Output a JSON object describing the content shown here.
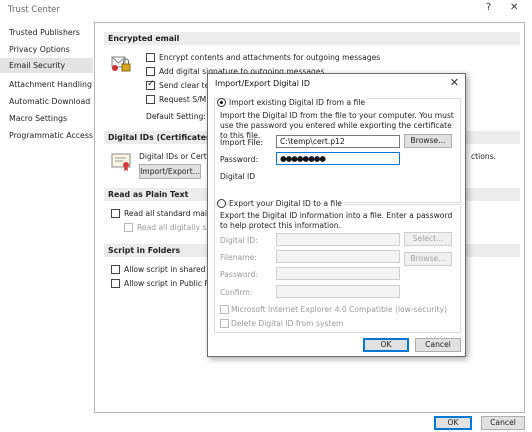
{
  "window": {
    "title": "Trust Center",
    "help_icon": "?",
    "close_icon": "✕"
  },
  "sidebar": {
    "items": [
      {
        "label": "Trusted Publishers"
      },
      {
        "label": "Privacy Options"
      },
      {
        "label": "Email Security"
      },
      {
        "label": "Attachment Handling"
      },
      {
        "label": "Automatic Download"
      },
      {
        "label": "Macro Settings"
      },
      {
        "label": "Programmatic Access"
      }
    ],
    "selected": "Email Security"
  },
  "encrypted_email": {
    "heading": "Encrypted email",
    "opt_encrypt": "Encrypt contents and attachments for outgoing messages",
    "opt_signature": "Add digital signature to outgoing messages",
    "opt_clear": "Send clear text",
    "opt_smime": "Request S/MIM",
    "default_setting_label": "Default Setting:"
  },
  "digital_ids": {
    "heading": "Digital IDs (Certificates)",
    "desc": "Digital IDs or Certif",
    "desc_tail": "ctions.",
    "import_export_button": "Import/Export..."
  },
  "plain_text": {
    "heading": "Read as Plain Text",
    "opt_read_all": "Read all standard mail in",
    "opt_read_signed": "Read all digitally sign"
  },
  "script_folders": {
    "heading": "Script in Folders",
    "opt_shared": "Allow script in shared fol",
    "opt_public": "Allow script in Public Fol"
  },
  "footer": {
    "ok": "OK",
    "cancel": "Cancel"
  },
  "dialog": {
    "title": "Import/Export Digital ID",
    "close": "✕",
    "import_radio": "Import existing Digital ID from a file",
    "import_desc": "Import the Digital ID from the file to your computer. You must use the password you entered while exporting the certificate to this file.",
    "import_file_label": "Import File:",
    "import_file_value": "C:\\temp\\cert.p12",
    "browse_label": "Browse...",
    "password_label": "Password:",
    "password_value": "●●●●●●●●",
    "digital_id_label": "Digital ID",
    "export_radio": "Export your Digital ID to a file",
    "export_desc": "Export the Digital ID information into a file. Enter a password to help protect this information.",
    "export_digital_id_label": "Digital ID:",
    "select_label": "Select...",
    "filename_label": "Filename:",
    "export_browse_label": "Browse...",
    "export_password_label": "Password:",
    "confirm_label": "Confirm:",
    "opt_ie4": "Microsoft Internet Explorer 4.0 Compatible (low-security)",
    "opt_delete": "Delete Digital ID from system",
    "ok": "OK",
    "cancel": "Cancel"
  },
  "colors": {
    "accent": "#0078d7",
    "section_bg": "#ececec",
    "selected_bg": "#e3e3e3"
  }
}
